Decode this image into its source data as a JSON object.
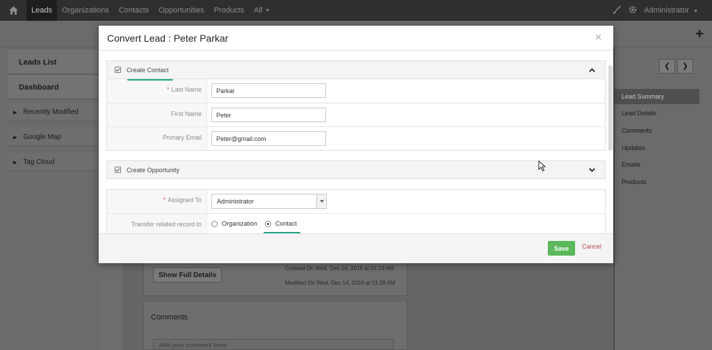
{
  "nav": {
    "items": [
      "Leads",
      "Organizations",
      "Contacts",
      "Opportunities",
      "Products",
      "All"
    ],
    "user": "Administrator"
  },
  "sidebar": {
    "blocks": [
      "Leads List",
      "Dashboard"
    ],
    "widgets": [
      "Recently Modified",
      "Google Map",
      "Tag Cloud"
    ]
  },
  "right_panel": {
    "items": [
      "Lead Summary",
      "Lead Details",
      "Comments",
      "Updates",
      "Emails",
      "Products"
    ]
  },
  "background": {
    "show_full_details": "Show Full Details",
    "created_on": "Created On Wed, Dec 14, 2016 at 01:19 AM",
    "modified_on": "Modified On Wed, Dec 14, 2016 at 01:28 AM",
    "comments_title": "Comments",
    "comment_placeholder": "Add your comment here"
  },
  "modal": {
    "title": "Convert Lead : Peter Parkar",
    "contact_section": {
      "label": "Create Contact",
      "checked": true,
      "fields": [
        {
          "label": "Last Name",
          "required": true,
          "value": "Parkar"
        },
        {
          "label": "First Name",
          "required": false,
          "value": "Peter"
        },
        {
          "label": "Primary Email",
          "required": false,
          "value": "Peter@gmail.com"
        }
      ]
    },
    "opportunity_section": {
      "label": "Create Opportunity",
      "checked": true
    },
    "assigned_to": {
      "label": "Assigned To",
      "required": true,
      "value": "Administrator"
    },
    "transfer": {
      "label": "Transfer related record to",
      "options": [
        "Organization",
        "Contact"
      ],
      "selected": "Contact"
    },
    "save_label": "Save",
    "cancel_label": "Cancel"
  },
  "colors": {
    "save": "#5cb85c",
    "highlight": "#1fa486",
    "cancel": "#b24c3e"
  }
}
